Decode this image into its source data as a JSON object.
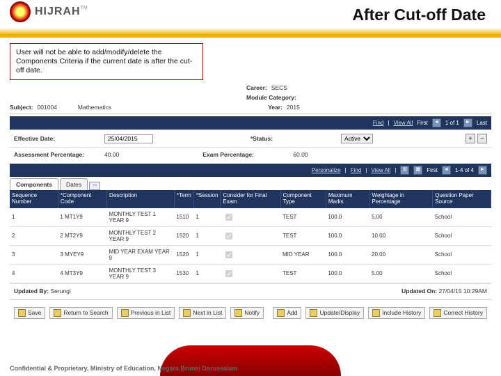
{
  "logo": {
    "text": "HIJRAH",
    "tm": "TM"
  },
  "title": "After Cut-off Date",
  "note": "User will not be able to add/modify/delete the Components Criteria if the current date is after the cut-off date.",
  "meta": {
    "career_lbl": "Career:",
    "career_val": "SECS",
    "module_lbl": "Module Category:",
    "subject_lbl": "Subject:",
    "subject_code": "001004",
    "subject_name": "Mathematics",
    "year_lbl": "Year:",
    "year_val": "2015"
  },
  "nav1": {
    "find": "Find",
    "viewall": "View All",
    "first": "First",
    "count": "1 of 1",
    "last": "Last"
  },
  "section1": {
    "effdate_lbl": "Effective Date:",
    "effdate_val": "25/04/2015",
    "status_lbl": "*Status:",
    "status_val": "Active",
    "assess_lbl": "Assessment Percentage:",
    "assess_val": "40.00",
    "exam_lbl": "Exam Percentage:",
    "exam_val": "60.00"
  },
  "nav2": {
    "personalize": "Personalize",
    "find": "Find",
    "viewall": "View All",
    "count": "1-4 of 4"
  },
  "tabs": {
    "t1": "Components",
    "t2": "Dates"
  },
  "headers": [
    "Sequence Number",
    "*Component Code",
    "Description",
    "*Term",
    "*Session",
    "Consider for Final Exam",
    "Component Type",
    "Maximum Marks",
    "Weightage in Percentage",
    "Question Paper Source"
  ],
  "rows": [
    {
      "seq": "1",
      "num": "1",
      "code": "MT1Y9",
      "desc": "MONTHLY TEST 1 YEAR 9",
      "term": "1510",
      "sess": "1",
      "cfe": true,
      "type": "TEST",
      "max": "100.0",
      "wt": "5.00",
      "src": "School"
    },
    {
      "seq": "2",
      "num": "2",
      "code": "MT2Y9",
      "desc": "MONTHLY TEST 2 YEAR 9",
      "term": "1520",
      "sess": "1",
      "cfe": true,
      "type": "TEST",
      "max": "100.0",
      "wt": "10.00",
      "src": "School"
    },
    {
      "seq": "3",
      "num": "3",
      "code": "MYEY9",
      "desc": "MID YEAR EXAM YEAR 9",
      "term": "1520",
      "sess": "1",
      "cfe": true,
      "type": "MID YEAR",
      "max": "100.0",
      "wt": "20.00",
      "src": "School"
    },
    {
      "seq": "4",
      "num": "4",
      "code": "MT3Y9",
      "desc": "MONTHLY TEST 3 YEAR 9",
      "term": "1530",
      "sess": "1",
      "cfe": true,
      "type": "TEST",
      "max": "100.0",
      "wt": "5.00",
      "src": "School"
    }
  ],
  "updated": {
    "by_lbl": "Updated By:",
    "by_val": "Serungi",
    "on_lbl": "Updated On:",
    "on_val": "27/04/15 10:29AM"
  },
  "buttons": {
    "save": "Save",
    "return": "Return to Search",
    "prev": "Previous in List",
    "next": "Next in List",
    "notify": "Notify",
    "add": "Add",
    "upd": "Update/Display",
    "inc": "Include History",
    "corr": "Correct History"
  },
  "footer": "Confidential & Proprietary, Ministry of Education, Negara Brunei Darussalam"
}
